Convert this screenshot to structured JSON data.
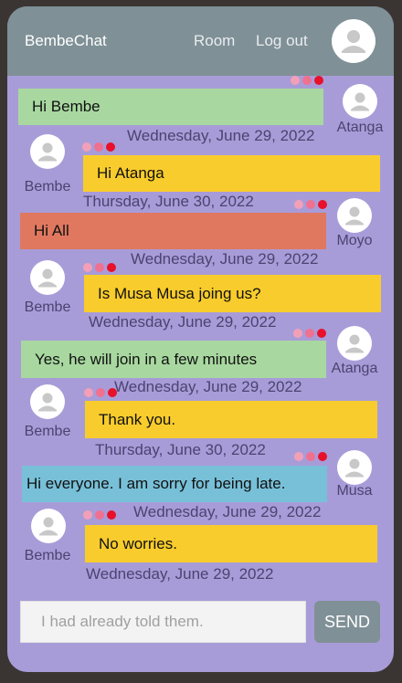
{
  "header": {
    "brand": "BembeChat",
    "room_label": "Room",
    "logout_label": "Log out"
  },
  "messages": [
    {
      "sender": "Atanga",
      "text": "Hi Bembe",
      "date": "Wednesday, June 29, 2022",
      "side": "right",
      "color": "#a8d8a0"
    },
    {
      "sender": "Bembe",
      "text": "Hi Atanga",
      "date": "Thursday, June 30, 2022",
      "side": "left",
      "color": "#f8cc2c"
    },
    {
      "sender": "Moyo",
      "text": "Hi All",
      "date": "Wednesday, June 29, 2022",
      "side": "right",
      "color": "#e07860"
    },
    {
      "sender": "Bembe",
      "text": "Is Musa Musa joing us?",
      "date": "Wednesday, June 29, 2022",
      "side": "left",
      "color": "#f8cc2c"
    },
    {
      "sender": "Atanga",
      "text": "Yes, he will join in a few minutes",
      "date": "Wednesday, June 29, 2022",
      "side": "right",
      "color": "#a8d8a0"
    },
    {
      "sender": "Bembe",
      "text": "Thank you.",
      "date": "Thursday, June 30, 2022",
      "side": "left",
      "color": "#f8cc2c"
    },
    {
      "sender": "Musa",
      "text": "Hi everyone. I am sorry for being late.",
      "date": "Wednesday, June 29, 2022",
      "side": "right",
      "color": "#78c0d8"
    },
    {
      "sender": "Bembe",
      "text": "No worries.",
      "date": "Wednesday, June 29, 2022",
      "side": "left",
      "color": "#f8cc2c"
    }
  ],
  "composer": {
    "placeholder": "I had already told them.",
    "send_label": "SEND"
  },
  "colors": {
    "background": "#a89cd8",
    "header": "#7f9096",
    "dot_light": "#f2a0b8",
    "dot_mid": "#f07090",
    "dot_strong": "#e8102a"
  }
}
